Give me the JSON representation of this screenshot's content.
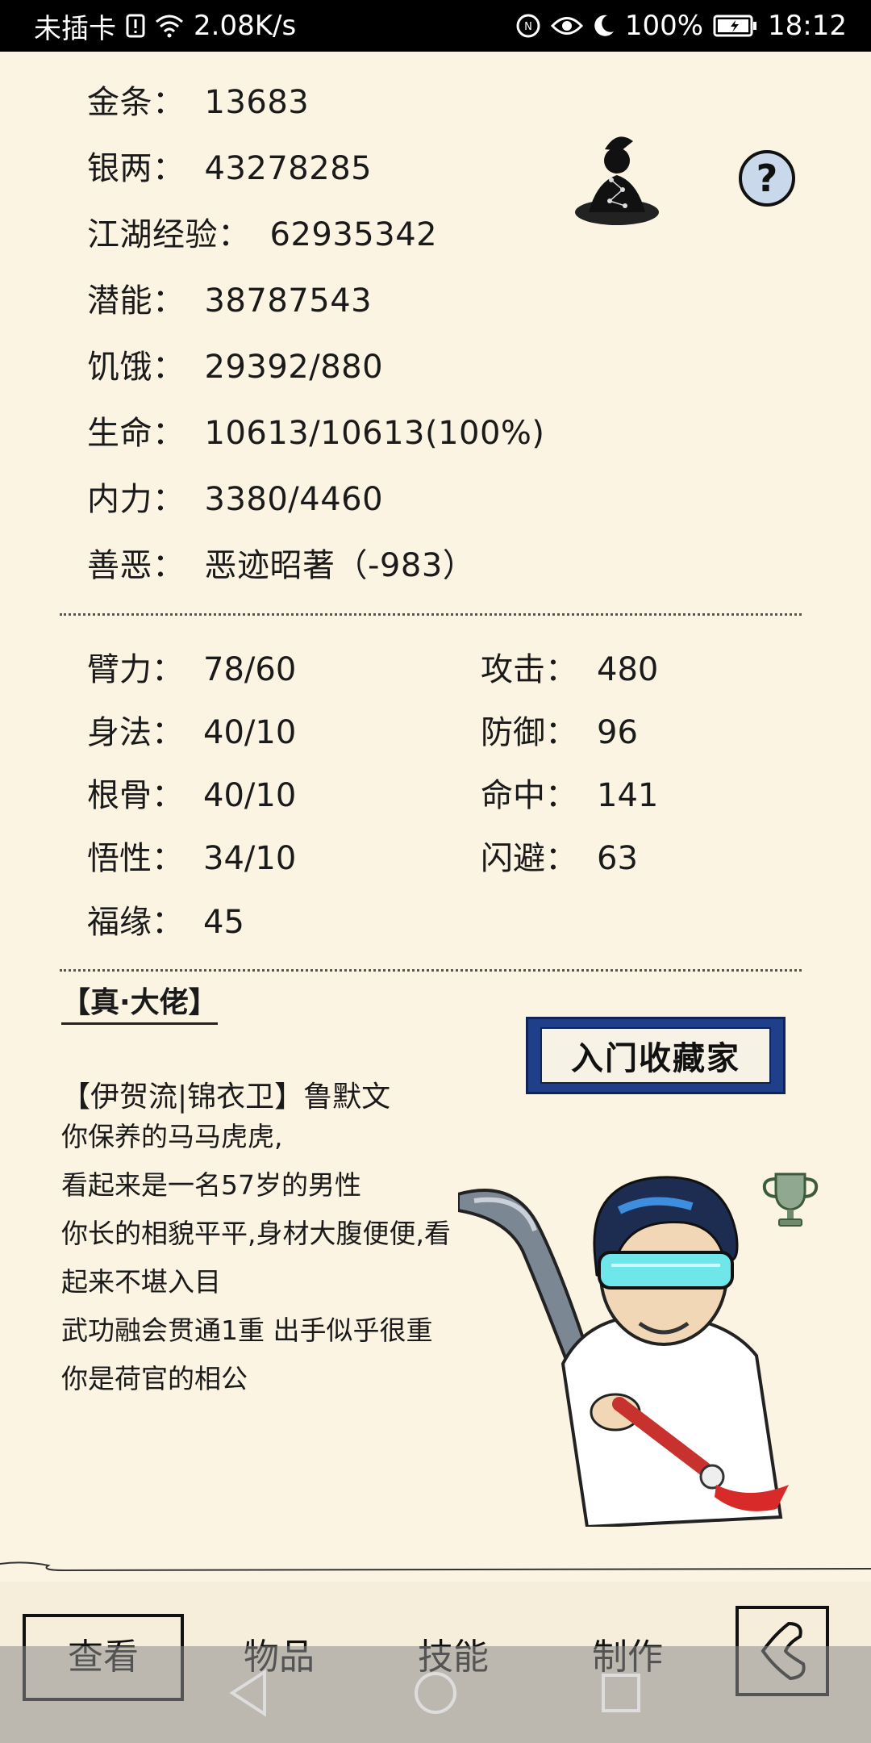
{
  "status_bar": {
    "carrier": "未插卡",
    "speed": "2.08K/s",
    "battery": "100%",
    "time": "18:12"
  },
  "stats": [
    {
      "label": "金条：",
      "value": "13683"
    },
    {
      "label": "银两：",
      "value": "43278285"
    },
    {
      "label": "江湖经验：",
      "value": "62935342"
    },
    {
      "label": "潜能：",
      "value": "38787543"
    },
    {
      "label": "饥饿：",
      "value": "29392/880"
    },
    {
      "label": "生命：",
      "value": "10613/10613(100%)"
    },
    {
      "label": "内力：",
      "value": "3380/4460"
    },
    {
      "label": "善恶：",
      "value": "恶迹昭著（-983）"
    }
  ],
  "attributes_left": [
    {
      "label": "臂力：",
      "value": "78/60"
    },
    {
      "label": "身法：",
      "value": "40/10"
    },
    {
      "label": "根骨：",
      "value": "40/10"
    },
    {
      "label": "悟性：",
      "value": "34/10"
    },
    {
      "label": "福缘：",
      "value": "45"
    }
  ],
  "attributes_right": [
    {
      "label": "攻击：",
      "value": "480"
    },
    {
      "label": "防御：",
      "value": "96"
    },
    {
      "label": "命中：",
      "value": "141"
    },
    {
      "label": "闪避：",
      "value": "63"
    }
  ],
  "profile": {
    "rank_title": "【真·大佬】",
    "lines": [
      "【伊贺流|锦衣卫】鲁默文",
      "你保养的马马虎虎,",
      "看起来是一名57岁的男性",
      "你长的相貌平平,身材大腹便便,看",
      "起来不堪入目",
      "武功融会贯通1重 出手似乎很重",
      "你是荷官的相公"
    ],
    "badge_text": "入门收藏家"
  },
  "help_label": "?",
  "nav": {
    "view": "查看",
    "items": "物品",
    "skills": "技能",
    "craft": "制作"
  },
  "icons": {
    "meditate": "meditating-figure-icon",
    "help": "question-icon",
    "trophy": "trophy-icon",
    "back": "back-arrow-icon"
  }
}
